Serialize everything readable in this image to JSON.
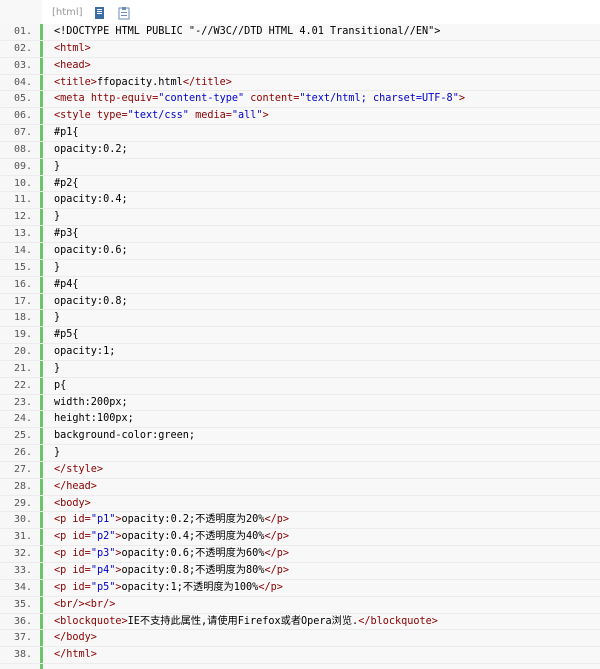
{
  "toolbar": {
    "tag_label": "[html]",
    "icons": [
      "copy-icon",
      "clipboard-icon"
    ]
  },
  "lines": [
    {
      "n": "01.",
      "parts": [
        {
          "t": "<!DOCTYPE HTML PUBLIC \"-//W3C//DTD HTML 4.01 Transitional//EN\">",
          "c": "blk"
        }
      ]
    },
    {
      "n": "02.",
      "parts": [
        {
          "t": "<html>",
          "c": "tag"
        }
      ]
    },
    {
      "n": "03.",
      "parts": [
        {
          "t": "<head>",
          "c": "tag"
        }
      ]
    },
    {
      "n": "04.",
      "parts": [
        {
          "t": "<title>",
          "c": "tag"
        },
        {
          "t": "ffopacity.html",
          "c": "blk"
        },
        {
          "t": "</title>",
          "c": "tag"
        }
      ]
    },
    {
      "n": "05.",
      "parts": [
        {
          "t": "<meta ",
          "c": "tag"
        },
        {
          "t": "http-equiv=",
          "c": "attr"
        },
        {
          "t": "\"content-type\"",
          "c": "str"
        },
        {
          "t": " content=",
          "c": "attr"
        },
        {
          "t": "\"text/html; charset=UTF-8\"",
          "c": "str"
        },
        {
          "t": ">",
          "c": "tag"
        }
      ]
    },
    {
      "n": "06.",
      "parts": [
        {
          "t": "<style ",
          "c": "tag"
        },
        {
          "t": "type=",
          "c": "attr"
        },
        {
          "t": "\"text/css\"",
          "c": "str"
        },
        {
          "t": " media=",
          "c": "attr"
        },
        {
          "t": "\"all\"",
          "c": "str"
        },
        {
          "t": ">",
          "c": "tag"
        }
      ]
    },
    {
      "n": "07.",
      "parts": [
        {
          "t": "#p1{",
          "c": "blk"
        }
      ]
    },
    {
      "n": "08.",
      "parts": [
        {
          "t": "opacity:0.2;",
          "c": "blk"
        }
      ]
    },
    {
      "n": "09.",
      "parts": [
        {
          "t": "}",
          "c": "blk"
        }
      ]
    },
    {
      "n": "10.",
      "parts": [
        {
          "t": "#p2{",
          "c": "blk"
        }
      ]
    },
    {
      "n": "11.",
      "parts": [
        {
          "t": "opacity:0.4;",
          "c": "blk"
        }
      ]
    },
    {
      "n": "12.",
      "parts": [
        {
          "t": "}",
          "c": "blk"
        }
      ]
    },
    {
      "n": "13.",
      "parts": [
        {
          "t": "#p3{",
          "c": "blk"
        }
      ]
    },
    {
      "n": "14.",
      "parts": [
        {
          "t": "opacity:0.6;",
          "c": "blk"
        }
      ]
    },
    {
      "n": "15.",
      "parts": [
        {
          "t": "}",
          "c": "blk"
        }
      ]
    },
    {
      "n": "16.",
      "parts": [
        {
          "t": "#p4{",
          "c": "blk"
        }
      ]
    },
    {
      "n": "17.",
      "parts": [
        {
          "t": "opacity:0.8;",
          "c": "blk"
        }
      ]
    },
    {
      "n": "18.",
      "parts": [
        {
          "t": "}",
          "c": "blk"
        }
      ]
    },
    {
      "n": "19.",
      "parts": [
        {
          "t": "#p5{",
          "c": "blk"
        }
      ]
    },
    {
      "n": "20.",
      "parts": [
        {
          "t": "opacity:1;",
          "c": "blk"
        }
      ]
    },
    {
      "n": "21.",
      "parts": [
        {
          "t": "}",
          "c": "blk"
        }
      ]
    },
    {
      "n": "22.",
      "parts": [
        {
          "t": "p{",
          "c": "blk"
        }
      ]
    },
    {
      "n": "23.",
      "parts": [
        {
          "t": "width:200px;",
          "c": "blk"
        }
      ]
    },
    {
      "n": "24.",
      "parts": [
        {
          "t": "height:100px;",
          "c": "blk"
        }
      ]
    },
    {
      "n": "25.",
      "parts": [
        {
          "t": "background-color:green;",
          "c": "blk"
        }
      ]
    },
    {
      "n": "26.",
      "parts": [
        {
          "t": "}",
          "c": "blk"
        }
      ]
    },
    {
      "n": "27.",
      "parts": [
        {
          "t": "</style>",
          "c": "tag"
        }
      ]
    },
    {
      "n": "28.",
      "parts": [
        {
          "t": "</head>",
          "c": "tag"
        }
      ]
    },
    {
      "n": "29.",
      "parts": [
        {
          "t": "<body>",
          "c": "tag"
        }
      ]
    },
    {
      "n": "30.",
      "parts": [
        {
          "t": "<p ",
          "c": "tag"
        },
        {
          "t": "id=",
          "c": "attr"
        },
        {
          "t": "\"p1\"",
          "c": "str"
        },
        {
          "t": ">",
          "c": "tag"
        },
        {
          "t": "opacity:0.2;不透明度为20%",
          "c": "blk"
        },
        {
          "t": "</p>",
          "c": "tag"
        }
      ]
    },
    {
      "n": "31.",
      "parts": [
        {
          "t": "<p ",
          "c": "tag"
        },
        {
          "t": "id=",
          "c": "attr"
        },
        {
          "t": "\"p2\"",
          "c": "str"
        },
        {
          "t": ">",
          "c": "tag"
        },
        {
          "t": "opacity:0.4;不透明度为40%",
          "c": "blk"
        },
        {
          "t": "</p>",
          "c": "tag"
        }
      ]
    },
    {
      "n": "32.",
      "parts": [
        {
          "t": "<p ",
          "c": "tag"
        },
        {
          "t": "id=",
          "c": "attr"
        },
        {
          "t": "\"p3\"",
          "c": "str"
        },
        {
          "t": ">",
          "c": "tag"
        },
        {
          "t": "opacity:0.6;不透明度为60%",
          "c": "blk"
        },
        {
          "t": "</p>",
          "c": "tag"
        }
      ]
    },
    {
      "n": "33.",
      "parts": [
        {
          "t": "<p ",
          "c": "tag"
        },
        {
          "t": "id=",
          "c": "attr"
        },
        {
          "t": "\"p4\"",
          "c": "str"
        },
        {
          "t": ">",
          "c": "tag"
        },
        {
          "t": "opacity:0.8;不透明度为80%",
          "c": "blk"
        },
        {
          "t": "</p>",
          "c": "tag"
        }
      ]
    },
    {
      "n": "34.",
      "parts": [
        {
          "t": "<p ",
          "c": "tag"
        },
        {
          "t": "id=",
          "c": "attr"
        },
        {
          "t": "\"p5\"",
          "c": "str"
        },
        {
          "t": ">",
          "c": "tag"
        },
        {
          "t": "opacity:1;不透明度为100%",
          "c": "blk"
        },
        {
          "t": "</p>",
          "c": "tag"
        }
      ]
    },
    {
      "n": "35.",
      "parts": [
        {
          "t": "<br/><br/>",
          "c": "tag"
        }
      ]
    },
    {
      "n": "36.",
      "parts": [
        {
          "t": "<blockquote>",
          "c": "tag"
        },
        {
          "t": "IE不支持此属性,请使用Firefox或者Opera浏览.",
          "c": "blk"
        },
        {
          "t": "</blockquote>",
          "c": "tag"
        }
      ]
    },
    {
      "n": "37.",
      "parts": [
        {
          "t": "</body>",
          "c": "tag"
        }
      ]
    },
    {
      "n": "38.",
      "parts": [
        {
          "t": "</html>",
          "c": "tag"
        }
      ]
    }
  ]
}
